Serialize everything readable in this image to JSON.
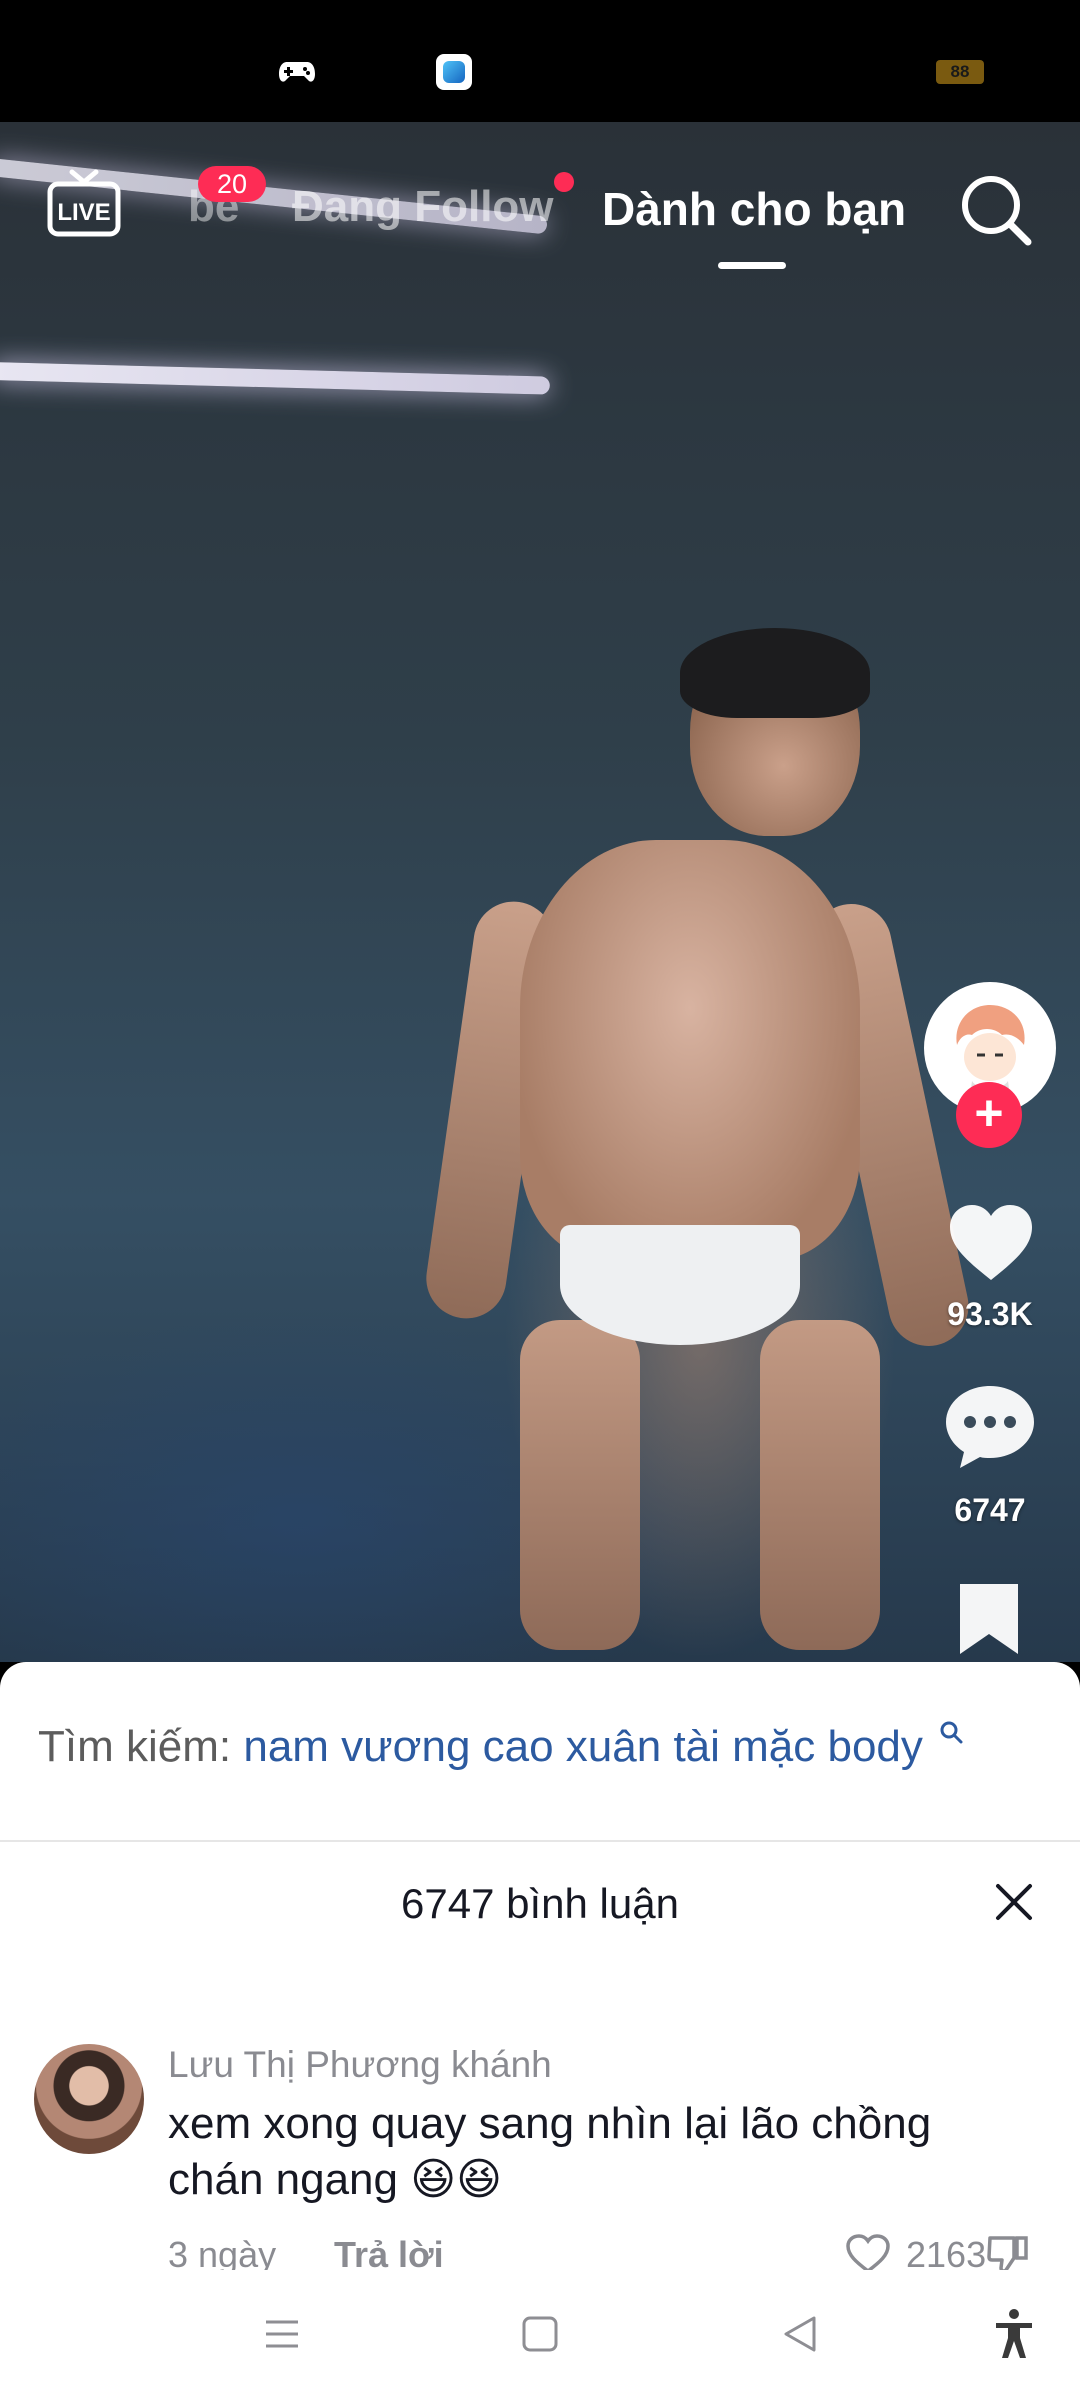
{
  "status_bar": {
    "battery": "88",
    "icons": [
      "gamepad-icon",
      "app-icon"
    ]
  },
  "top_nav": {
    "live_label": "LIVE",
    "tab_friends": "be",
    "friends_badge": "20",
    "tab_following": "Đang Follow",
    "tab_for_you": "Dành cho bạn"
  },
  "video_actions": {
    "like_count": "93.3K",
    "comment_count": "6747"
  },
  "comment_sheet": {
    "search_label": "Tìm kiếm:",
    "search_query": "nam vương cao xuân tài mặc body",
    "title": "6747 bình luận",
    "comments": [
      {
        "username": "Lưu Thị Phương khánh",
        "text": "xem xong quay sang nhìn lại lão chồng chán ngang 😆😆",
        "date": "3 ngày",
        "reply_label": "Trả lời",
        "likes": "2163"
      }
    ]
  },
  "colors": {
    "accent": "#fe2c55",
    "link": "#2c5aa0",
    "muted_text": "#8a8b91"
  }
}
